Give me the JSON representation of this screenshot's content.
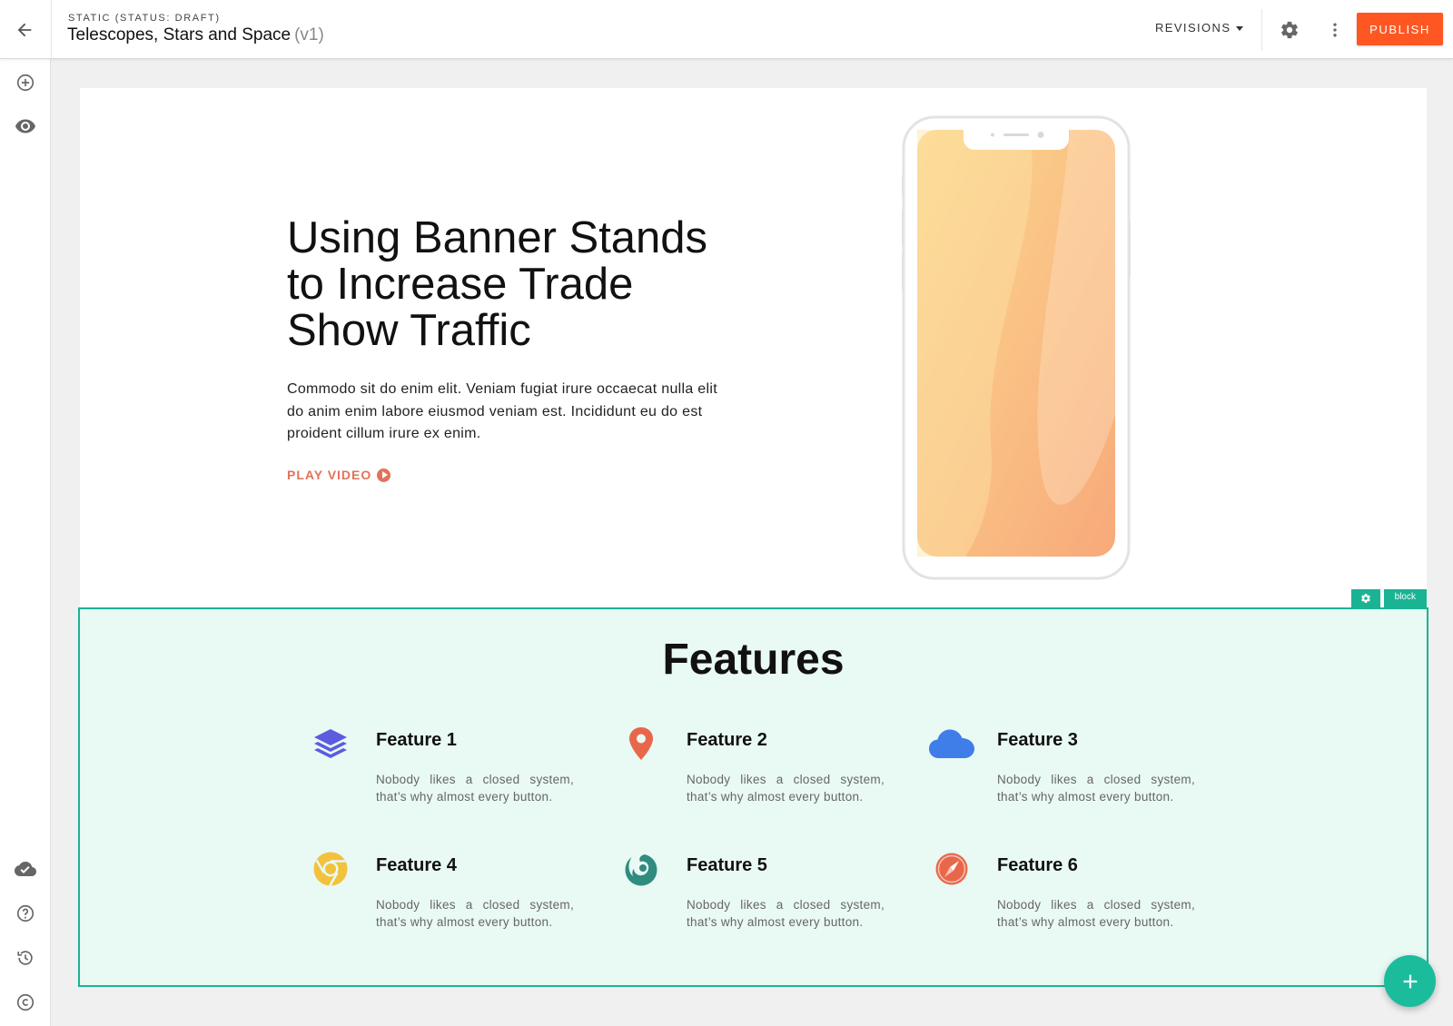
{
  "header": {
    "status": "STATIC (STATUS: DRAFT)",
    "title": "Telescopes, Stars and Space",
    "version": "(v1)",
    "revisions_label": "REVISIONS",
    "publish_label": "PUBLISH",
    "publish_color": "#ff5722"
  },
  "sidebar": {
    "top_items": [
      "add-icon",
      "eye-icon"
    ],
    "bottom_items": [
      "cloud-done-icon",
      "help-icon",
      "history-icon",
      "copyright-icon"
    ]
  },
  "hero": {
    "title": "Using Banner Stands to Increase Trade Show Traffic",
    "text": "Commodo sit do enim elit. Veniam fugiat irure occaecat nulla elit do anim enim labore eiusmod veniam est. Incididunt eu do est proident cillum irure ex enim.",
    "play_label": "PLAY VIDEO",
    "accent": "#e0735a"
  },
  "block": {
    "label": "block",
    "accent": "#1ab394"
  },
  "features": {
    "title": "Features",
    "items": [
      {
        "name": "Feature 1",
        "desc": "Nobody likes a closed system, that’s why almost every button.",
        "icon": "layers-icon",
        "color": "#5b5ce0"
      },
      {
        "name": "Feature 2",
        "desc": "Nobody likes a closed system, that’s why almost every button.",
        "icon": "map-pin-icon",
        "color": "#e8674a"
      },
      {
        "name": "Feature 3",
        "desc": "Nobody likes a closed system, that’s why almost every button.",
        "icon": "cloud-icon",
        "color": "#3f7de8"
      },
      {
        "name": "Feature 4",
        "desc": "Nobody likes a closed system, that’s why almost every button.",
        "icon": "chrome-icon",
        "color": "#f2c23c"
      },
      {
        "name": "Feature 5",
        "desc": "Nobody likes a closed system, that’s why almost every button.",
        "icon": "firefox-icon",
        "color": "#2f8c7f"
      },
      {
        "name": "Feature 6",
        "desc": "Nobody likes a closed system, that’s why almost every button.",
        "icon": "compass-icon",
        "color": "#e8674a"
      }
    ]
  }
}
